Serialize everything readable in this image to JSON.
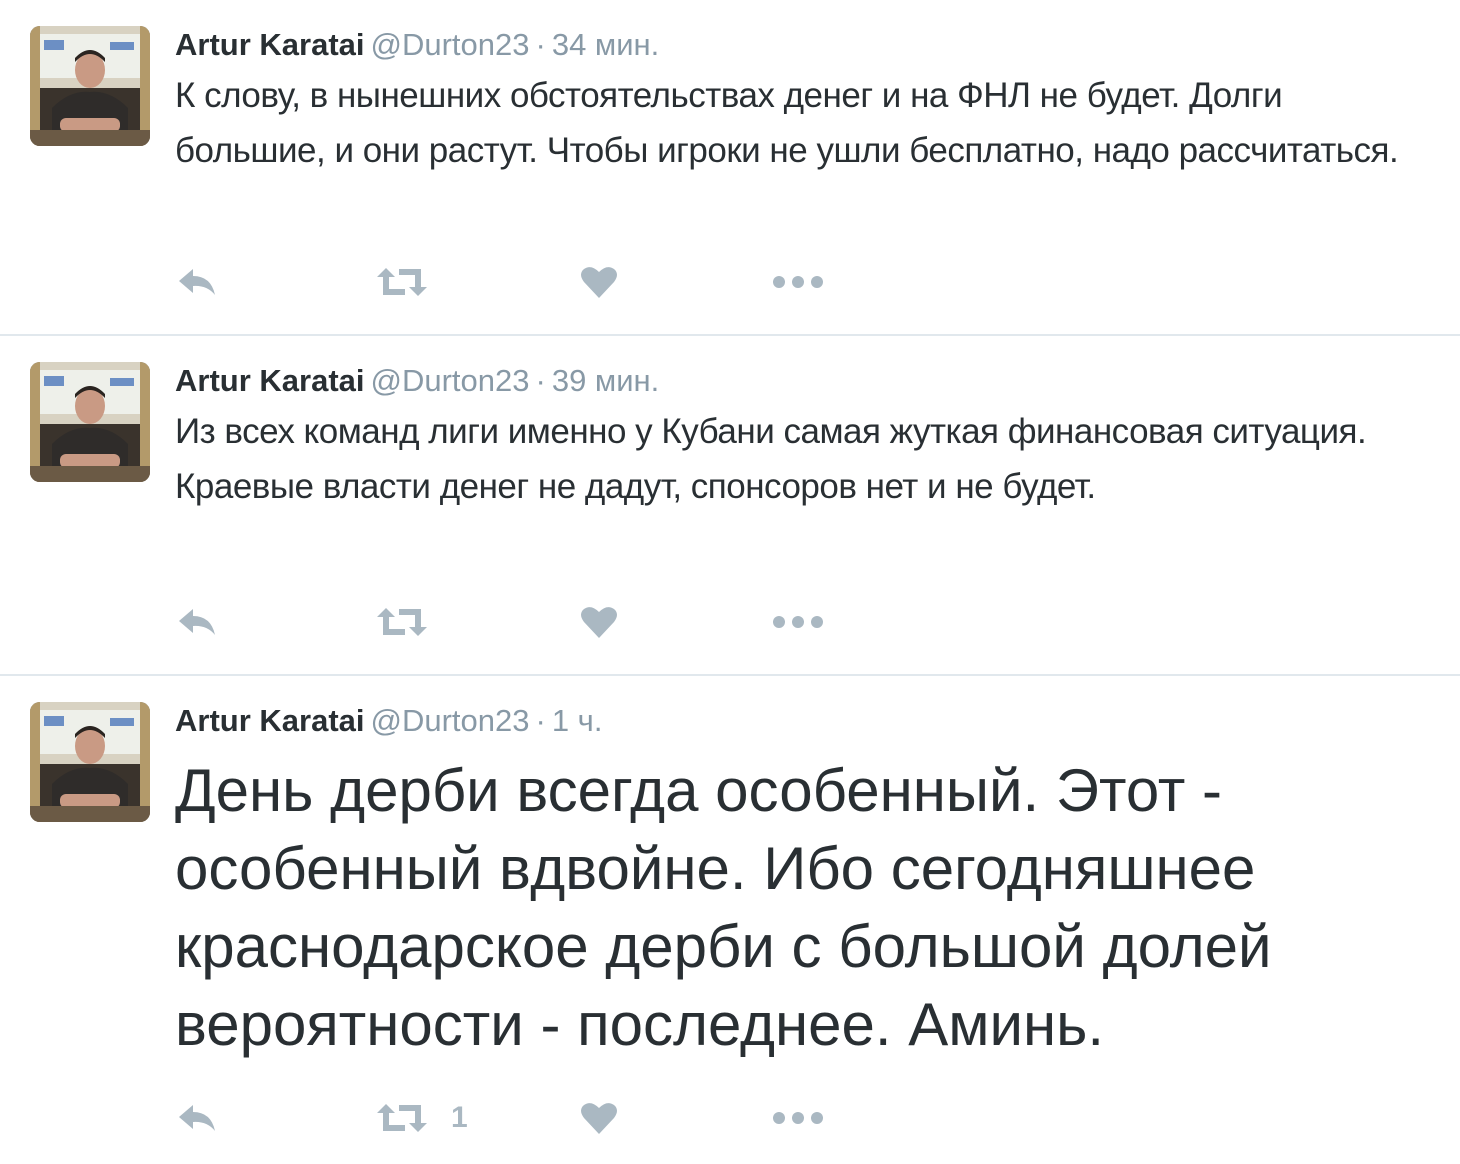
{
  "colors": {
    "text": "#292f33",
    "muted": "#8899a6",
    "icon": "#aab8c2",
    "divider": "#e1e8ed"
  },
  "tweets": [
    {
      "fullname": "Artur Karatai",
      "username": "@Durton23",
      "separator": "·",
      "time": "34 мин.",
      "text": "К слову, в нынешних обстоятельствах денег и на ФНЛ не будет. Долги большие, и они растут. Чтобы игроки не ушли бесплатно, надо рассчитаться.",
      "retweet_count": ""
    },
    {
      "fullname": "Artur Karatai",
      "username": "@Durton23",
      "separator": "·",
      "time": "39 мин.",
      "text": "Из всех команд лиги именно у Кубани самая жуткая финансовая ситуация. Краевые власти денег не дадут, спонсоров нет и не будет.",
      "retweet_count": ""
    },
    {
      "fullname": "Artur Karatai",
      "username": "@Durton23",
      "separator": "·",
      "time": "1 ч.",
      "text": "День дерби всегда особенный. Этот - особенный вдвойне. Ибо сегодняшнее краснодарское дерби с большой долей вероятности - последнее. Аминь.",
      "retweet_count": "1"
    }
  ],
  "icons": {
    "reply": "reply-icon",
    "retweet": "retweet-icon",
    "like": "heart-icon",
    "more": "more-dots-icon"
  }
}
